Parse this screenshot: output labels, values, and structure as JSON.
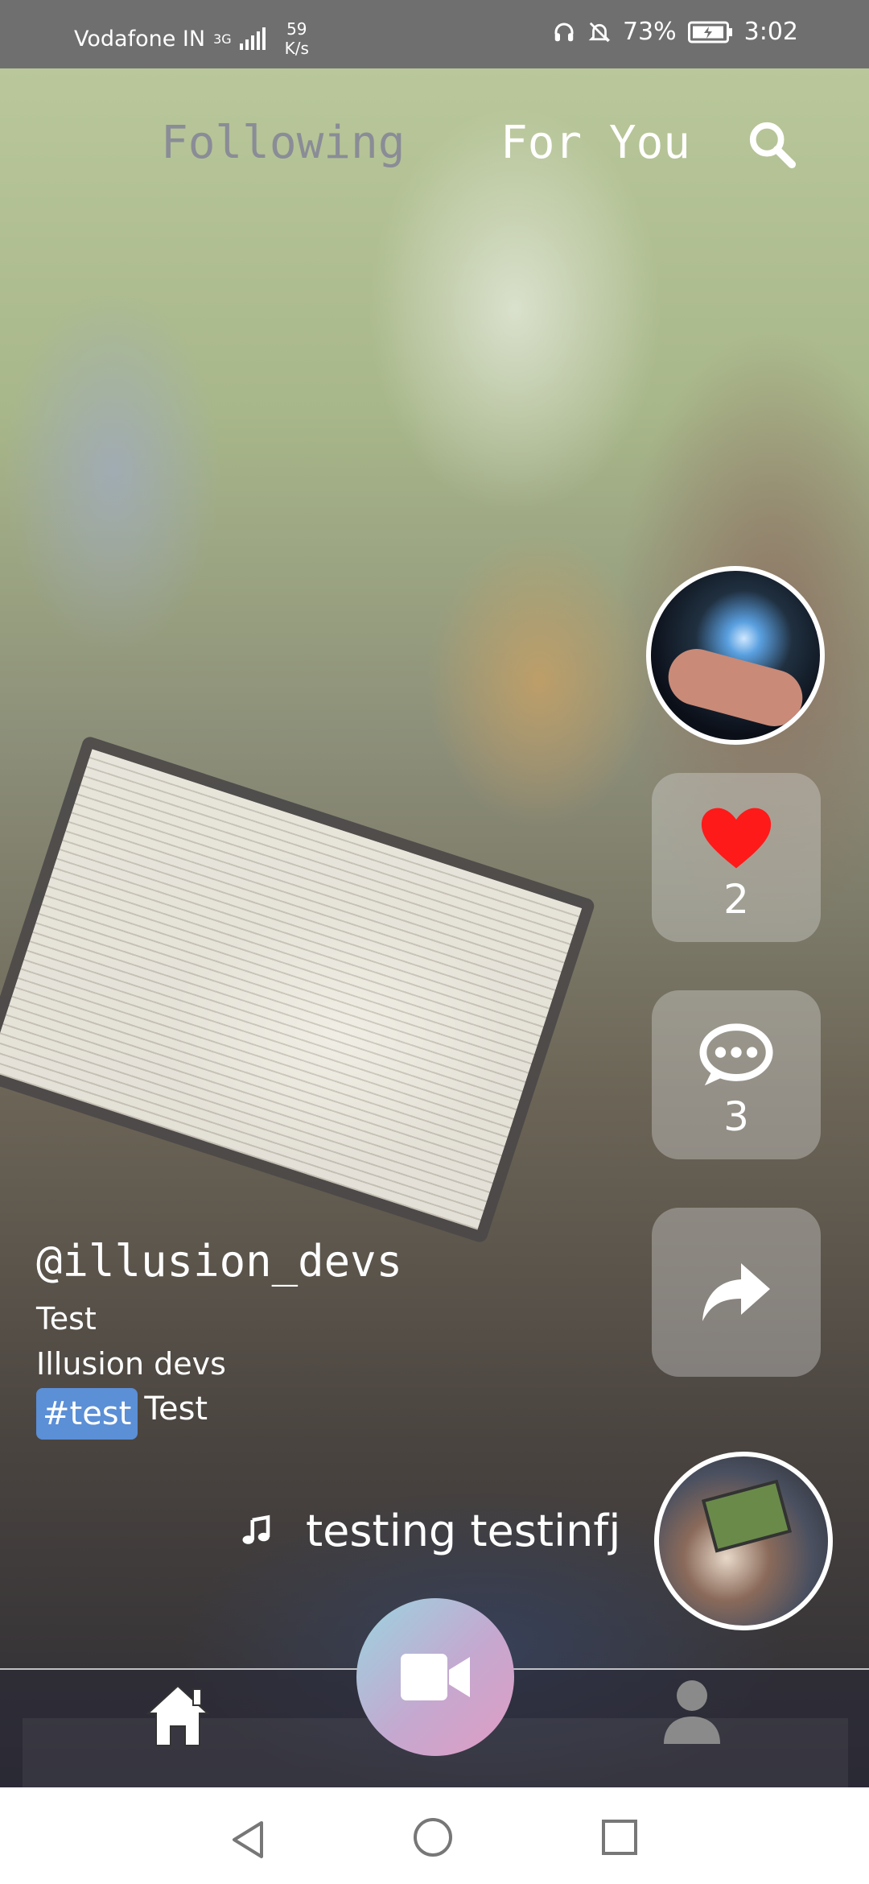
{
  "status_bar": {
    "carrier": "Vodafone IN",
    "network_type": "3G",
    "net_speed_value": "59",
    "net_speed_unit": "K/s",
    "battery": "73%",
    "time": "3:02"
  },
  "top_tabs": {
    "following": "Following",
    "for_you": "For You",
    "active": "For You"
  },
  "video": {
    "username": "@illusion_devs",
    "description_line1": "Test",
    "description_line2": "Illusion devs",
    "hashtag": "#test",
    "hashtag_suffix": "Test",
    "music_title": "testing testinfj"
  },
  "actions": {
    "like_count": "2",
    "comment_count": "3"
  },
  "colors": {
    "like": "#ff1a1a",
    "hashtag_bg": "#5b8fd6",
    "record_gradient": [
      "#9ad4e0",
      "#e09cc4"
    ]
  }
}
